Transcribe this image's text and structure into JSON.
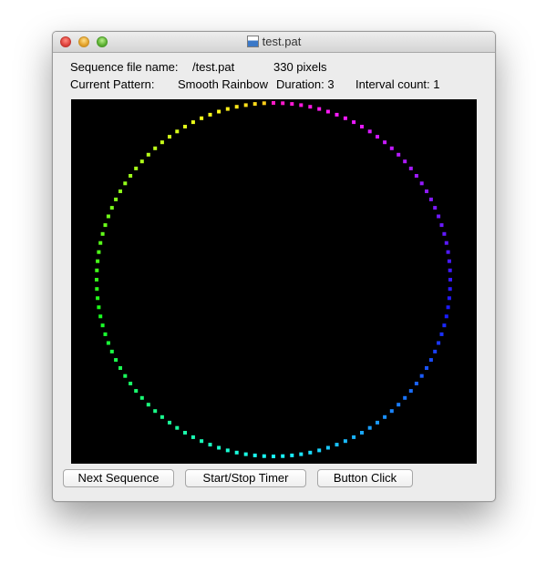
{
  "window": {
    "title": "test.pat"
  },
  "info": {
    "sequence_label": "Sequence file name:",
    "sequence_value": "/test.pat",
    "pixels": "330 pixels",
    "pattern_label": "Current Pattern:",
    "pattern_value": "Smooth Rainbow",
    "duration": "Duration: 3",
    "interval": "Interval count: 1"
  },
  "display": {
    "background": "#000000",
    "dot_color_scheme": "rainbow-hue"
  },
  "buttons": {
    "next": "Next Sequence",
    "timer": "Start/Stop Timer",
    "click": "Button Click"
  }
}
